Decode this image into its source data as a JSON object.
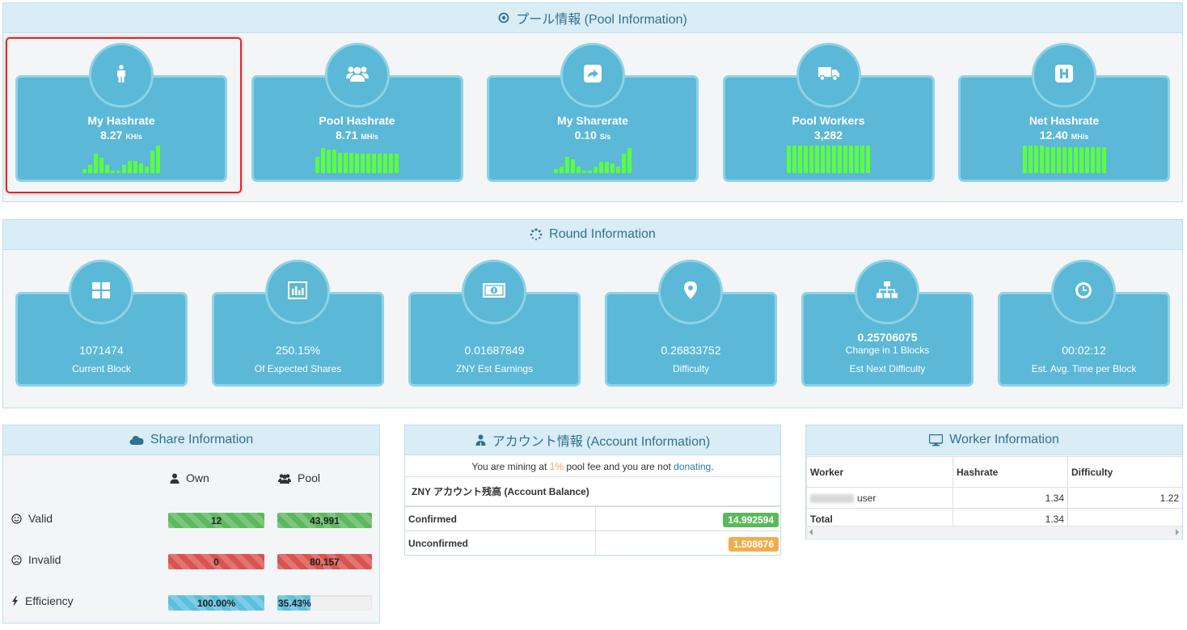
{
  "pool": {
    "title": "プール情報 (Pool Information)",
    "stats": [
      {
        "title": "My Hashrate",
        "value": "8.27",
        "unit": "KH/s",
        "spark": [
          3,
          6,
          14,
          11,
          6,
          2,
          2,
          6,
          9,
          9,
          7,
          5,
          16,
          20
        ]
      },
      {
        "title": "Pool Hashrate",
        "value": "8.71",
        "unit": "MH/s",
        "spark": [
          12,
          18,
          17,
          17,
          15,
          15,
          15,
          14,
          14,
          14,
          14,
          14,
          14,
          14,
          14
        ]
      },
      {
        "title": "My Sharerate",
        "value": "0.10",
        "unit": "S/s",
        "spark": [
          3,
          5,
          12,
          10,
          5,
          2,
          2,
          5,
          8,
          8,
          7,
          5,
          14,
          18
        ]
      },
      {
        "title": "Pool Workers",
        "value": "3,282",
        "unit": "",
        "spark": [
          20,
          20,
          20,
          20,
          20,
          20,
          20,
          20,
          20,
          20,
          20,
          20,
          20,
          20,
          20
        ]
      },
      {
        "title": "Net Hashrate",
        "value": "12.40",
        "unit": "MH/s",
        "spark": [
          20,
          20,
          20,
          20,
          19,
          19,
          19,
          19,
          19,
          19,
          19,
          19,
          19,
          19,
          19
        ]
      }
    ]
  },
  "round": {
    "title": "Round Information",
    "stats": [
      {
        "icon": "blocks-icon",
        "value": "1071474",
        "label": "Current Block"
      },
      {
        "icon": "chart-icon",
        "value": "250.15%",
        "label": "Of Expected Shares"
      },
      {
        "icon": "money-icon",
        "value": "0.01687849",
        "label": "ZNY Est Earnings"
      },
      {
        "icon": "map-marker-icon",
        "value": "0.26833752",
        "label": "Difficulty"
      },
      {
        "icon": "sitemap-icon",
        "value": "0.25706075",
        "sub": "Change in 1 Blocks",
        "label": "Est Next Difficulty"
      },
      {
        "icon": "clock-icon",
        "value": "00:02:12",
        "label": "Est. Avg. Time per Block"
      }
    ]
  },
  "share": {
    "title": "Share Information",
    "own_label": "Own",
    "pool_label": "Pool",
    "valid_label": "Valid",
    "invalid_label": "Invalid",
    "efficiency_label": "Efficiency",
    "valid_own": "12",
    "valid_pool": "43,991",
    "invalid_own": "0",
    "invalid_pool": "80,157",
    "eff_own": "100.00%",
    "eff_pool": "35.43%",
    "eff_own_pct": 100,
    "eff_pool_pct": 35.43
  },
  "account": {
    "title": "アカウント情報 (Account Information)",
    "mining_pre": "You are mining at ",
    "fee": "1%",
    "mining_mid": " pool fee and you are not ",
    "donating": "donating",
    "mining_post": ".",
    "balance_title": "ZNY アカウント残高 (Account Balance)",
    "confirmed_label": "Confirmed",
    "confirmed_value": "14.992594",
    "unconfirmed_label": "Unconfirmed",
    "unconfirmed_value": "1.508676"
  },
  "worker": {
    "title": "Worker Information",
    "col_worker": "Worker",
    "col_hashrate": "Hashrate",
    "col_difficulty": "Difficulty",
    "row_name": "user",
    "row_hashrate": "1.34",
    "row_difficulty": "1.22",
    "total_label": "Total",
    "total_hashrate": "1.34"
  },
  "colors": {
    "accent": "#5bb8d6",
    "spark": "#5cff3e",
    "green": "#5cb85c",
    "red": "#d9534f",
    "blue": "#5bc0de",
    "orange": "#f0ad4e"
  }
}
